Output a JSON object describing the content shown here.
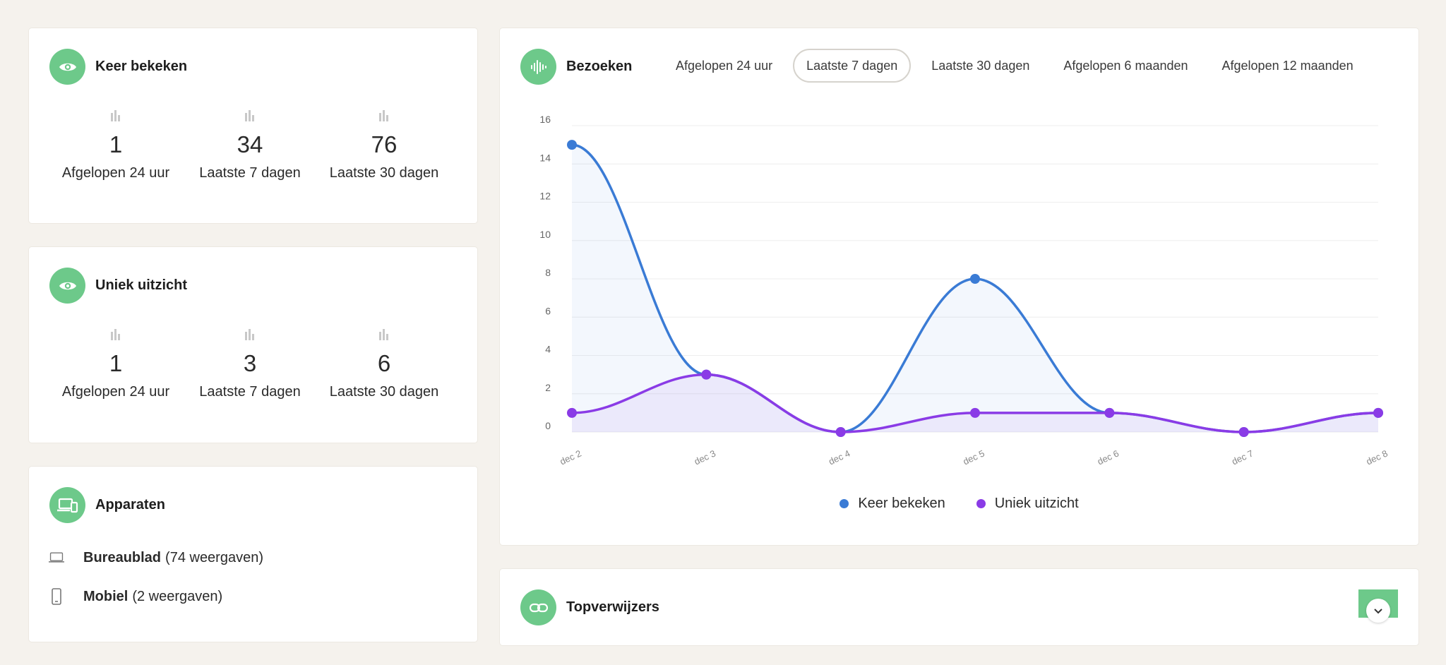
{
  "colors": {
    "accent": "#6dc98a",
    "series_views": "#3a7bd5",
    "series_unique": "#8a3be6"
  },
  "views_card": {
    "title": "Keer bekeken",
    "icon": "eye-icon",
    "stats": [
      {
        "value": "1",
        "label": "Afgelopen 24 uur"
      },
      {
        "value": "34",
        "label": "Laatste 7 dagen"
      },
      {
        "value": "76",
        "label": "Laatste 30 dagen"
      }
    ]
  },
  "unique_card": {
    "title": "Uniek uitzicht",
    "icon": "eye-icon",
    "stats": [
      {
        "value": "1",
        "label": "Afgelopen 24 uur"
      },
      {
        "value": "3",
        "label": "Laatste 7 dagen"
      },
      {
        "value": "6",
        "label": "Laatste 30 dagen"
      }
    ]
  },
  "devices_card": {
    "title": "Apparaten",
    "icon": "devices-icon",
    "items": [
      {
        "icon": "laptop-icon",
        "name": "Bureaublad",
        "count": "(74 weergaven)"
      },
      {
        "icon": "phone-icon",
        "name": "Mobiel",
        "count": "(2 weergaven)"
      }
    ]
  },
  "visits_card": {
    "title": "Bezoeken",
    "icon": "waveform-icon",
    "tabs": [
      {
        "label": "Afgelopen 24 uur",
        "active": false
      },
      {
        "label": "Laatste 7 dagen",
        "active": true
      },
      {
        "label": "Laatste 30 dagen",
        "active": false
      },
      {
        "label": "Afgelopen 6 maanden",
        "active": false
      },
      {
        "label": "Afgelopen 12 maanden",
        "active": false
      }
    ]
  },
  "referrers_card": {
    "title": "Topverwijzers",
    "icon": "link-icon"
  },
  "chart_data": {
    "type": "area",
    "categories": [
      "dec 2",
      "dec 3",
      "dec 4",
      "dec 5",
      "dec 6",
      "dec 7",
      "dec 8"
    ],
    "series": [
      {
        "name": "Keer bekeken",
        "values": [
          15,
          3,
          0,
          8,
          1,
          0,
          1
        ],
        "color": "#3a7bd5"
      },
      {
        "name": "Uniek uitzicht",
        "values": [
          1,
          3,
          0,
          1,
          1,
          0,
          1
        ],
        "color": "#8a3be6"
      }
    ],
    "ylim": [
      0,
      16
    ],
    "yticks": [
      0,
      2,
      4,
      6,
      8,
      10,
      12,
      14,
      16
    ],
    "grid": true,
    "legend": "bottom-center",
    "smooth": true
  }
}
